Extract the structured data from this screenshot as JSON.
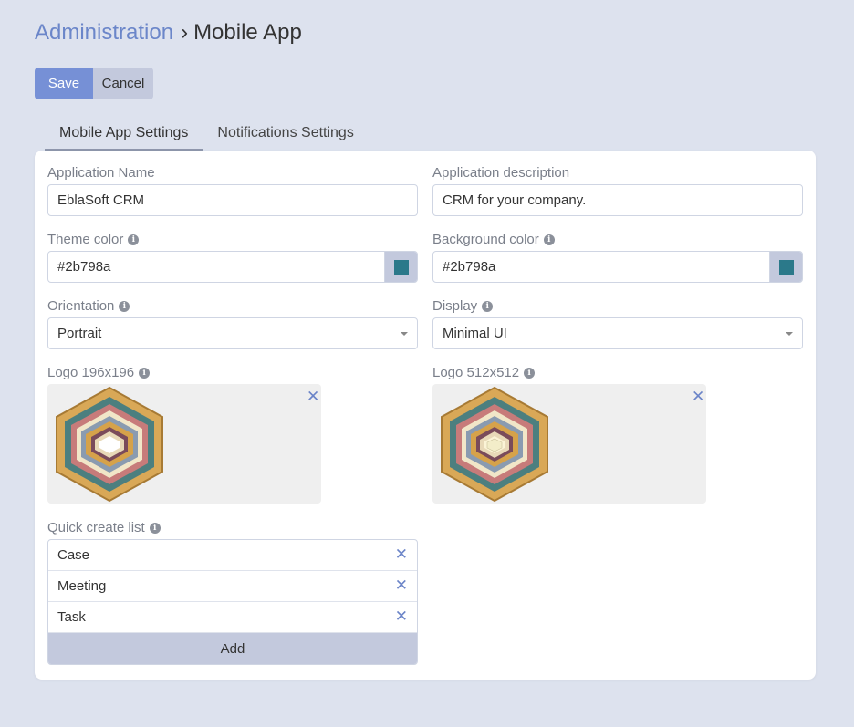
{
  "breadcrumb": {
    "parent": "Administration",
    "separator": "›",
    "current": "Mobile App"
  },
  "actions": {
    "save": "Save",
    "cancel": "Cancel"
  },
  "tabs": [
    {
      "label": "Mobile App Settings",
      "active": true
    },
    {
      "label": "Notifications Settings",
      "active": false
    }
  ],
  "form": {
    "app_name": {
      "label": "Application Name",
      "value": "EblaSoft CRM"
    },
    "app_description": {
      "label": "Application description",
      "value": "CRM for your company."
    },
    "theme_color": {
      "label": "Theme color",
      "value": "#2b798a"
    },
    "background_color": {
      "label": "Background color",
      "value": "#2b798a"
    },
    "orientation": {
      "label": "Orientation",
      "value": "Portrait"
    },
    "display": {
      "label": "Display",
      "value": "Minimal UI"
    },
    "logo_small": {
      "label": "Logo 196x196"
    },
    "logo_large": {
      "label": "Logo 512x512"
    },
    "quick_create": {
      "label": "Quick create list",
      "items": [
        "Case",
        "Meeting",
        "Task"
      ],
      "add_label": "Add"
    }
  },
  "icons": {
    "info": "info-icon",
    "remove": "close-icon",
    "dropdown": "chevron-down-icon"
  },
  "colors": {
    "accent": "#7690d6",
    "swatch": "#2b798a",
    "page_bg": "#dde2ee",
    "secondary_button": "#c3c9dd"
  }
}
